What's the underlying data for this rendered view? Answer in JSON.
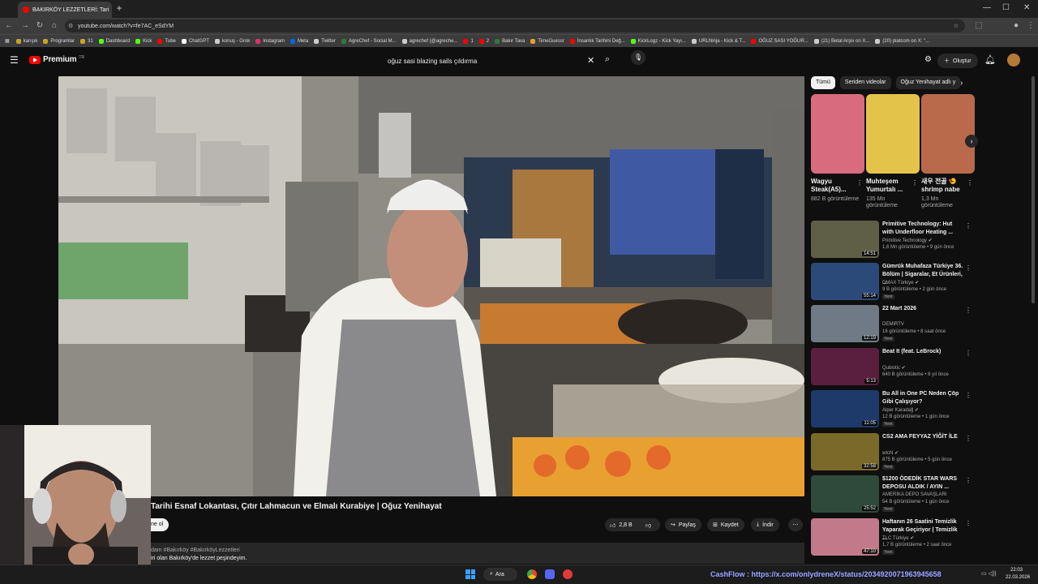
{
  "browser": {
    "tab_title": "BAKIRKÖY LEZZETLERİ: Tari",
    "new_tab": "+",
    "url": "youtube.com/watch?v=fe7AC_eSdYM",
    "bookmarks": [
      {
        "label": "karışık",
        "color": "#c9a227"
      },
      {
        "label": "Programlar",
        "color": "#c9a227"
      },
      {
        "label": "31",
        "color": "#c9a227"
      },
      {
        "label": "Dashboard",
        "color": "#53fc18"
      },
      {
        "label": "Kick",
        "color": "#53fc18"
      },
      {
        "label": "Tube",
        "color": "#ff0000"
      },
      {
        "label": "ChatGPT",
        "color": "#ffffff"
      },
      {
        "label": "konuş - Grok",
        "color": "#cccccc"
      },
      {
        "label": "Instagram",
        "color": "#e1306c"
      },
      {
        "label": "Meta",
        "color": "#0668e1"
      },
      {
        "label": "Twitter",
        "color": "#cccccc"
      },
      {
        "label": "AgreChef - Social M...",
        "color": "#2c7a3f"
      },
      {
        "label": "agrechef (@agreche...",
        "color": "#cccccc"
      },
      {
        "label": "1",
        "color": "#ff0000"
      },
      {
        "label": "2",
        "color": "#ff0000"
      },
      {
        "label": "Bakır Tava",
        "color": "#2c7a3f"
      },
      {
        "label": "TimeGuessr",
        "color": "#e0a030"
      },
      {
        "label": "İnsanlık Tarihini Değ...",
        "color": "#ff0000"
      },
      {
        "label": "KickLogz - Kick Yayı...",
        "color": "#53fc18"
      },
      {
        "label": "URLNinja - Kick & T...",
        "color": "#cccccc"
      },
      {
        "label": "OĞUZ SASI YOĞUR...",
        "color": "#ff0000"
      },
      {
        "label": "(21) Betal Arşiv on X...",
        "color": "#cccccc"
      },
      {
        "label": "(20) platcom on X: \"...",
        "color": "#cccccc"
      }
    ]
  },
  "youtube": {
    "logo": "Premium",
    "logo_sup": "TR",
    "search_query": "oğuz sasi blazing sails çıldırma",
    "create_label": "Oluştur"
  },
  "video": {
    "title": "Tarihi Esnaf Lokantası, Çıtır Lahmacun ve Elmalı Kurabiye | Oğuz Yenihayat",
    "subscribe_label": "ne ol",
    "likes": "2,8 B",
    "share": "Paylaş",
    "save": "Kaydet",
    "download": "İndir",
    "desc_line1": "dam #Bakırköy #BakırköyLezzetleri",
    "desc_line2": "iri olan Bakırköy'de lezzet peşindeyim."
  },
  "chips": [
    "Tümü",
    "Seriden videolar",
    "Oğuz Yenihayat adlı y"
  ],
  "shorts": [
    {
      "title": "Wagyu Steak(A5)...",
      "views": "882 B görüntüleme",
      "color": "#d86b7d"
    },
    {
      "title": "Muhteşem Yumurtalı ...",
      "views": "135 Mn görüntüleme",
      "color": "#e3c34a"
    },
    {
      "title": "새우 전골 🍤 shrimp nabe",
      "views": "1,3 Mn görüntüleme",
      "color": "#b86a4a"
    }
  ],
  "recommendations": [
    {
      "title": "Primitive Technology: Hut with Underfloor Heating ...",
      "channel": "Primitive Technology ✔",
      "views": "1,6 Mn görüntüleme • 9 gün önce",
      "duration": "14:51",
      "badge": "",
      "color": "#5f5e47"
    },
    {
      "title": "Gümrük Muhafaza Türkiye 36. Bölüm | Sigaralar, Et Ürünleri, ...",
      "channel": "DMAX Türkiye ✔",
      "views": "9 B görüntüleme • 2 gün önce",
      "duration": "55:14",
      "badge": "Yeni",
      "color": "#2b4a7a"
    },
    {
      "title": "22 Mart 2026",
      "channel": "DEMIRTV",
      "views": "16 görüntüleme • 8 saat önce",
      "duration": "12:19",
      "badge": "Yeni",
      "color": "#6f7a86"
    },
    {
      "title": "Beat It (feat. LeBrock)",
      "channel": "Qubiotic ✔",
      "views": "640 B görüntüleme • 6 yıl önce",
      "duration": "5:13",
      "badge": "",
      "color": "#5a1f3f"
    },
    {
      "title": "Bu All in One PC Neden Çöp Gibi Çalışıyor?",
      "channel": "Alper Karadağ ✔",
      "views": "12 B görüntüleme • 1 gün önce",
      "duration": "11:05",
      "badge": "Yeni",
      "color": "#1d3a6a"
    },
    {
      "title": "CS2 AMA FEYYAZ YİĞİT İLE",
      "channel": "wtcN ✔",
      "views": "875 B görüntüleme • 5 gün önce",
      "duration": "32:58",
      "badge": "Yeni",
      "color": "#7a6a2a"
    },
    {
      "title": "$1200 ÖDEDİK STAR WARS DEPOSU ALDIK / AYIN ...",
      "channel": "AMERİKA DEPO SAVAŞLARI",
      "views": "54 B görüntüleme • 1 gün önce",
      "duration": "25:52",
      "badge": "Yeni",
      "color": "#2f4a3a"
    },
    {
      "title": "Haftanın 26 Saatini Temizlik Yaparak Geçiriyor | Temizlik ...",
      "channel": "TLC Türkiye ✔",
      "views": "1,7 B görüntüleme • 2 saat önce",
      "duration": "47:10",
      "badge": "Yeni",
      "color": "#c27a8a"
    }
  ],
  "taskbar": {
    "search_label": "Ara",
    "ticker": "CashFlow : https://x.com/onlydreneX/status/2034920071963945658",
    "time": "22:03",
    "date": "22.03.2026"
  }
}
